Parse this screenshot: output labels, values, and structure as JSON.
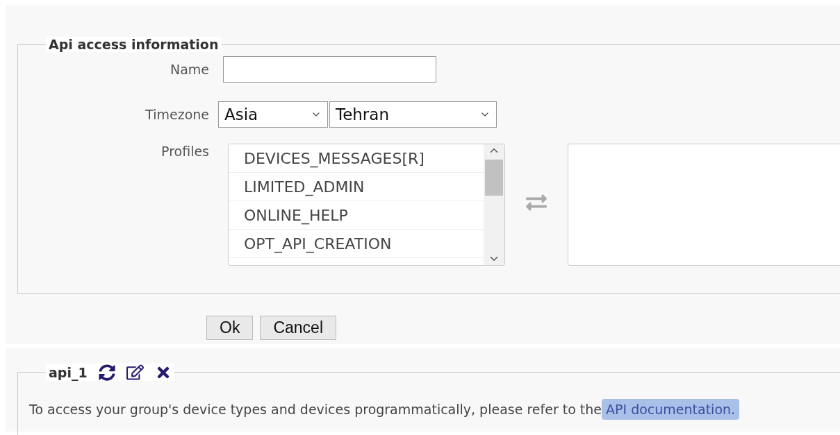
{
  "form": {
    "legend": "Api access information",
    "name_field": {
      "label": "Name"
    },
    "timezone": {
      "label": "Timezone",
      "region": "Asia",
      "city": "Tehran"
    },
    "profiles": {
      "label": "Profiles",
      "available": [
        {
          "label": "DEVICES_MESSAGES[R]",
          "selected": false
        },
        {
          "label": "LIMITED_ADMIN",
          "selected": false
        },
        {
          "label": "ONLINE_HELP",
          "selected": false
        },
        {
          "label": "OPT_API_CREATION",
          "selected": false
        }
      ]
    }
  },
  "buttons": [
    "Ok",
    "Cancel"
  ],
  "api_panel": {
    "legend": "api_1",
    "text": "To access your group's device types and devices programmatically, please refer to the",
    "link": "API documentation."
  }
}
